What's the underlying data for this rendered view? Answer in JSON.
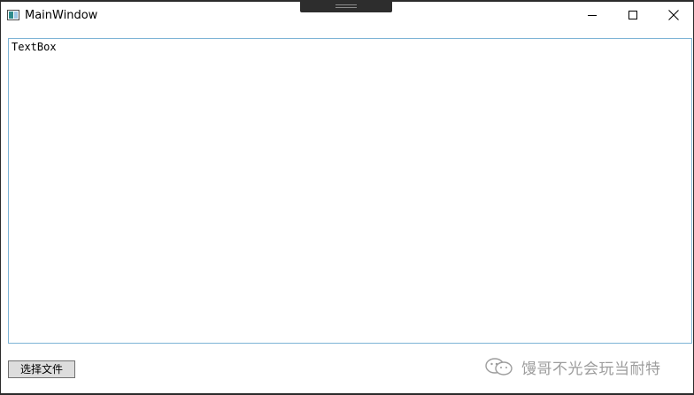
{
  "window": {
    "title": "MainWindow",
    "controls": {
      "minimize": "minimize",
      "maximize": "maximize",
      "close": "close"
    }
  },
  "textbox": {
    "value": "TextBox"
  },
  "actions": {
    "select_file_label": "选择文件"
  },
  "watermark": {
    "text": "馒哥不光会玩当耐特",
    "icon": "wechat-icon"
  },
  "colors": {
    "textbox_border": "#7eb4d6",
    "button_face": "#dddddd",
    "window_border": "#2b2b2b"
  }
}
